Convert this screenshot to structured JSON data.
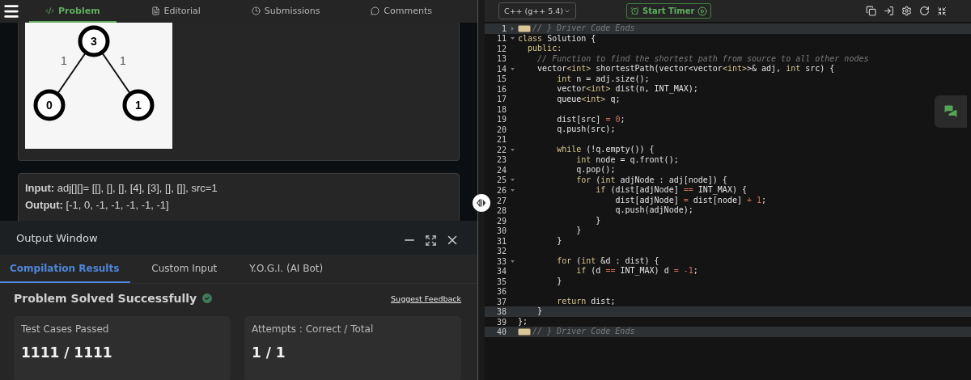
{
  "nav": {
    "tabs": [
      {
        "label": "Problem",
        "selected": true
      },
      {
        "label": "Editorial",
        "selected": false
      },
      {
        "label": "Submissions",
        "selected": false
      },
      {
        "label": "Comments",
        "selected": false
      }
    ]
  },
  "graph": {
    "nodes": [
      "3",
      "0",
      "1"
    ],
    "edges": [
      "1",
      "1"
    ]
  },
  "example": {
    "input": "**Input:** adj[][]= [[], [], [], [4], [3], [], []], src=1",
    "output": "**Output:** [-1, 0, -1, -1, -1, -1, -1]"
  },
  "output_window": {
    "title": "Output Window",
    "tabs": [
      {
        "label": "Compilation Results",
        "selected": true
      },
      {
        "label": "Custom Input",
        "selected": false
      },
      {
        "label": "Y.O.G.I. (AI Bot)",
        "selected": false
      }
    ],
    "status": "Problem Solved Successfully",
    "success": true,
    "feedback_link": "Suggest Feedback",
    "stats": [
      {
        "label": "Test Cases Passed",
        "value": "1111 / 1111"
      },
      {
        "label": "Attempts : Correct / Total",
        "value": "1 / 1"
      }
    ]
  },
  "editor": {
    "language": "C++ (g++ 5.4)",
    "timer_button": "Start Timer",
    "lines": [
      {
        "n": "1",
        "foldable": true,
        "collapsed": true,
        "highlighted": true,
        "tokens": [
          {
            "text": "// } Driver Code Ends",
            "kind": "comment"
          }
        ]
      },
      {
        "n": "11",
        "foldable": true,
        "collapsed": false,
        "tokens": [
          {
            "text": "class",
            "kind": "keyword"
          },
          {
            "text": " Solution {",
            "kind": "plain"
          }
        ]
      },
      {
        "n": "12",
        "tokens": [
          {
            "text": "  public:",
            "kind": "keyword"
          }
        ]
      },
      {
        "n": "13",
        "tokens": [
          {
            "text": "    // Function to find the shortest path from source to all other nodes",
            "kind": "comment"
          }
        ]
      },
      {
        "n": "14",
        "foldable": true,
        "collapsed": false,
        "tokens": [
          {
            "text": "    vector",
            "kind": "plain"
          },
          {
            "text": "<int>",
            "kind": "keyword"
          },
          {
            "text": " shortestPath(vector<vector",
            "kind": "plain"
          },
          {
            "text": "<int>",
            "kind": "keyword"
          },
          {
            "text": ">& adj, ",
            "kind": "plain"
          },
          {
            "text": "int",
            "kind": "keyword"
          },
          {
            "text": " src) {",
            "kind": "plain"
          }
        ]
      },
      {
        "n": "15",
        "tokens": [
          {
            "text": "        int",
            "kind": "keyword"
          },
          {
            "text": " n = adj.size();",
            "kind": "plain"
          }
        ]
      },
      {
        "n": "16",
        "tokens": [
          {
            "text": "        vector",
            "kind": "plain"
          },
          {
            "text": "<int>",
            "kind": "keyword"
          },
          {
            "text": " dist(n, INT_MAX);",
            "kind": "plain"
          }
        ]
      },
      {
        "n": "17",
        "tokens": [
          {
            "text": "        queue",
            "kind": "plain"
          },
          {
            "text": "<int>",
            "kind": "keyword"
          },
          {
            "text": " q;",
            "kind": "plain"
          }
        ]
      },
      {
        "n": "18"
      },
      {
        "n": "19",
        "tokens": [
          {
            "text": "        dist[src] ",
            "kind": "plain"
          },
          {
            "text": "= 0",
            "kind": "operator"
          },
          {
            "text": ";",
            "kind": "plain"
          }
        ]
      },
      {
        "n": "20",
        "tokens": [
          {
            "text": "        q.push(src);",
            "kind": "plain"
          }
        ]
      },
      {
        "n": "21"
      },
      {
        "n": "22",
        "foldable": true,
        "collapsed": false,
        "tokens": [
          {
            "text": "        while",
            "kind": "keyword"
          },
          {
            "text": " (!q.empty()) {",
            "kind": "plain"
          }
        ]
      },
      {
        "n": "23",
        "tokens": [
          {
            "text": "            int",
            "kind": "keyword"
          },
          {
            "text": " node = q.front();",
            "kind": "plain"
          }
        ]
      },
      {
        "n": "24",
        "tokens": [
          {
            "text": "            q.pop();",
            "kind": "plain"
          }
        ]
      },
      {
        "n": "25",
        "foldable": true,
        "collapsed": false,
        "tokens": [
          {
            "text": "            for",
            "kind": "keyword"
          },
          {
            "text": " (",
            "kind": "plain"
          },
          {
            "text": "int",
            "kind": "keyword"
          },
          {
            "text": " adjNode : adj[node]) {",
            "kind": "plain"
          }
        ]
      },
      {
        "n": "26",
        "foldable": true,
        "collapsed": false,
        "tokens": [
          {
            "text": "                if",
            "kind": "keyword"
          },
          {
            "text": " (dist[adjNode] ",
            "kind": "plain"
          },
          {
            "text": "==",
            "kind": "operator"
          },
          {
            "text": " INT_MAX) {",
            "kind": "plain"
          }
        ]
      },
      {
        "n": "27",
        "tokens": [
          {
            "text": "                    dist[adjNode] ",
            "kind": "plain"
          },
          {
            "text": "=",
            "kind": "operator"
          },
          {
            "text": " dist[node] ",
            "kind": "plain"
          },
          {
            "text": "+ 1",
            "kind": "operator"
          },
          {
            "text": ";",
            "kind": "plain"
          }
        ]
      },
      {
        "n": "28",
        "tokens": [
          {
            "text": "                    q.push(adjNode);",
            "kind": "plain"
          }
        ]
      },
      {
        "n": "29",
        "tokens": [
          {
            "text": "                }",
            "kind": "plain"
          }
        ]
      },
      {
        "n": "30",
        "tokens": [
          {
            "text": "            }",
            "kind": "plain"
          }
        ]
      },
      {
        "n": "31",
        "tokens": [
          {
            "text": "        }",
            "kind": "plain"
          }
        ]
      },
      {
        "n": "32"
      },
      {
        "n": "33",
        "foldable": true,
        "collapsed": false,
        "tokens": [
          {
            "text": "        for",
            "kind": "keyword"
          },
          {
            "text": " (",
            "kind": "plain"
          },
          {
            "text": "int",
            "kind": "keyword"
          },
          {
            "text": " &d : dist) {",
            "kind": "plain"
          }
        ]
      },
      {
        "n": "34",
        "tokens": [
          {
            "text": "            if",
            "kind": "keyword"
          },
          {
            "text": " (d ",
            "kind": "plain"
          },
          {
            "text": "==",
            "kind": "operator"
          },
          {
            "text": " INT_MAX) d ",
            "kind": "plain"
          },
          {
            "text": "= -1",
            "kind": "operator"
          },
          {
            "text": ";",
            "kind": "plain"
          }
        ]
      },
      {
        "n": "35",
        "tokens": [
          {
            "text": "        }",
            "kind": "plain"
          }
        ]
      },
      {
        "n": "36"
      },
      {
        "n": "37",
        "tokens": [
          {
            "text": "        return",
            "kind": "keyword"
          },
          {
            "text": " dist;",
            "kind": "plain"
          }
        ]
      },
      {
        "n": "38",
        "highlighted": true,
        "tokens": [
          {
            "text": "    }",
            "kind": "plain"
          }
        ]
      },
      {
        "n": "39",
        "tokens": [
          {
            "text": "};",
            "kind": "plain"
          }
        ]
      },
      {
        "n": "40",
        "collapsed": true,
        "highlighted": true,
        "tokens": [
          {
            "text": "// } Driver Code Ends",
            "kind": "comment"
          }
        ]
      }
    ]
  }
}
